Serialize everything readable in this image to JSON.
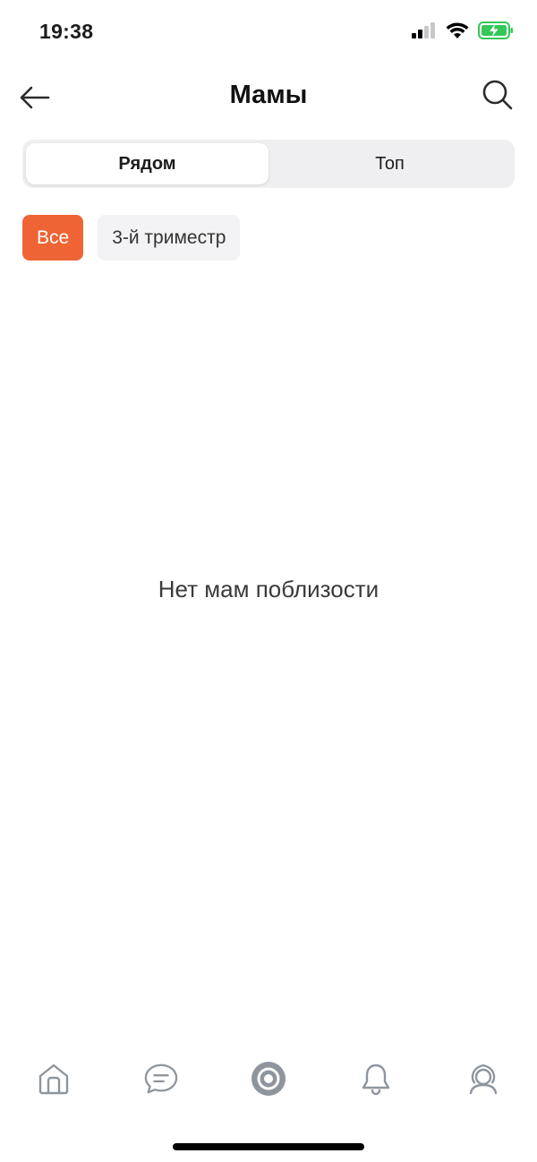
{
  "status_bar": {
    "time": "19:38",
    "icons": [
      "cellular-signal-icon",
      "wifi-icon",
      "battery-charging-icon"
    ],
    "battery_color": "#34c759"
  },
  "nav": {
    "title": "Мамы",
    "back_icon": "arrow-left-icon",
    "search_icon": "search-icon"
  },
  "segmented": {
    "items": [
      {
        "label": "Рядом",
        "active": true
      },
      {
        "label": "Топ",
        "active": false
      }
    ]
  },
  "chips": [
    {
      "label": "Все",
      "active": true
    },
    {
      "label": "3-й триместр",
      "active": false
    }
  ],
  "empty_state": {
    "text": "Нет мам поблизости"
  },
  "tab_bar": {
    "items": [
      {
        "icon": "home-icon",
        "active": false
      },
      {
        "icon": "chat-icon",
        "active": false
      },
      {
        "icon": "target-icon",
        "active": true
      },
      {
        "icon": "bell-icon",
        "active": false
      },
      {
        "icon": "profile-icon",
        "active": false
      }
    ],
    "icon_color": "#8e959d"
  },
  "colors": {
    "accent": "#ee6434"
  }
}
